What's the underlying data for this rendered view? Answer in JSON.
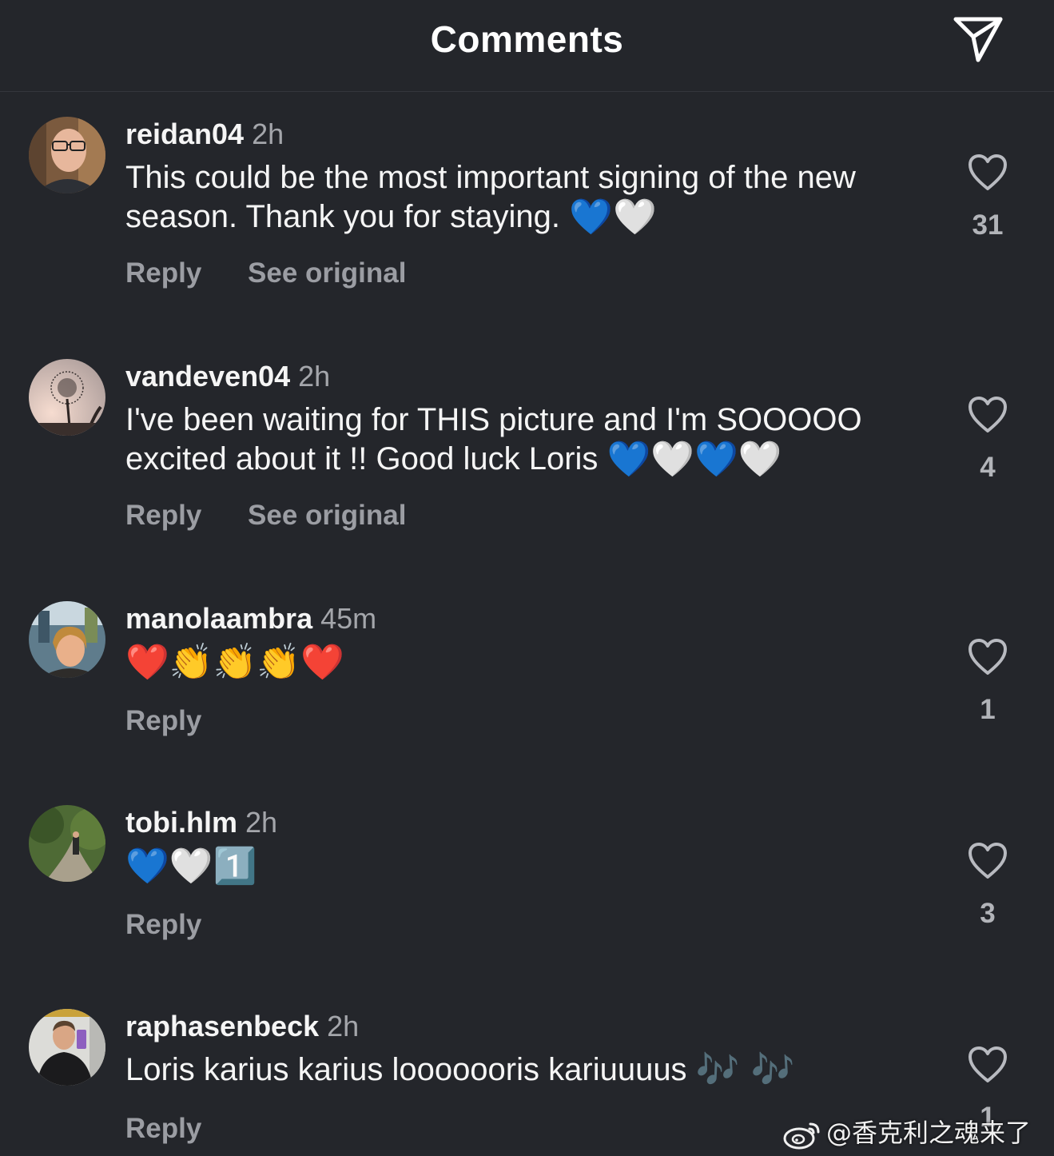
{
  "header": {
    "title": "Comments",
    "send_icon": "paper-plane-icon"
  },
  "comments": [
    {
      "username": "reidan04",
      "time": "2h",
      "text": "This could be the most important signing of the new season. Thank you for staying.",
      "emojis": "💙🤍",
      "reply_label": "Reply",
      "see_original_label": "See original",
      "likes": "31",
      "avatar": "man-with-glasses-photo"
    },
    {
      "username": "vandeven04",
      "time": "2h",
      "text": "I've been waiting for THIS picture and I'm SOOOOO excited about it !! Good luck Loris",
      "emojis": "💙🤍💙🤍",
      "reply_label": "Reply",
      "see_original_label": "See original",
      "likes": "4",
      "avatar": "dandelion-photo"
    },
    {
      "username": "manolaambra",
      "time": "45m",
      "text": "",
      "emojis": "❤️👏👏👏❤️",
      "reply_label": "Reply",
      "likes": "1",
      "avatar": "woman-selfie-photo"
    },
    {
      "username": "tobi.hlm",
      "time": "2h",
      "text": "",
      "emojis": "💙🤍1️⃣",
      "reply_label": "Reply",
      "likes": "3",
      "avatar": "forest-path-photo"
    },
    {
      "username": "raphasenbeck",
      "time": "2h",
      "text": "Loris karius karius looooooris kariuuuus",
      "emojis": "🎶 🎶",
      "reply_label": "Reply",
      "likes": "1",
      "avatar": "man-mirror-selfie-photo"
    }
  ],
  "watermark": {
    "text": "@香克利之魂来了",
    "logo": "weibo-logo"
  },
  "colors": {
    "background": "#24262b",
    "text": "#f5f5f5",
    "secondary": "#9b9da3",
    "heart_blue": "#1e63e8",
    "heart_white": "#f2f2f2",
    "heart_red": "#e0161c",
    "clap": "#f4c02a"
  }
}
